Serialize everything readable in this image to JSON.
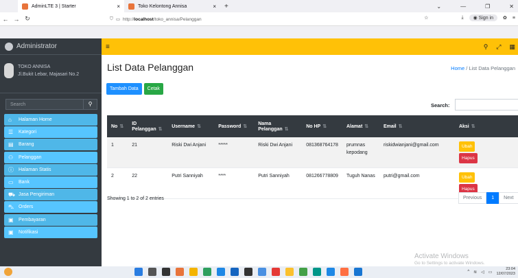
{
  "browser": {
    "tabs": [
      {
        "label": "AdminLTE 3 | Starter",
        "active": true
      },
      {
        "label": "Toko Kelontong Annisa",
        "active": false
      }
    ],
    "url_prefix": "http://",
    "url_host": "localhost",
    "url_path": "/toko_annisa/Pelanggan",
    "signin": "Sign in"
  },
  "sidebar": {
    "brand": "Administrator",
    "user_name": "TOKO ANNISA",
    "user_address": "Jl.Bukit Lebar, Majasari No.2",
    "search_placeholder": "Search",
    "items": [
      {
        "label": "Halaman Home",
        "icon": "home-icon"
      },
      {
        "label": "Kategori",
        "icon": "list-icon"
      },
      {
        "label": "Barang",
        "icon": "box-icon"
      },
      {
        "label": "Pelanggan",
        "icon": "users-icon"
      },
      {
        "label": "Halaman Statis",
        "icon": "info-icon"
      },
      {
        "label": "Bank",
        "icon": "bank-icon"
      },
      {
        "label": "Jasa Pengiriman",
        "icon": "truck-icon"
      },
      {
        "label": "Orders",
        "icon": "cart-icon"
      },
      {
        "label": "Pembayaran",
        "icon": "money-icon"
      },
      {
        "label": "Notifikasi",
        "icon": "bell-icon"
      }
    ]
  },
  "page": {
    "title": "List Data Pelanggan",
    "breadcrumb_home": "Home",
    "breadcrumb_current": "List Data Pelanggan",
    "add_button": "Tambah Data",
    "print_button": "Cetak",
    "search_label": "Search:"
  },
  "table": {
    "columns": [
      "No",
      "ID Pelanggan",
      "Username",
      "Password",
      "Nama Pelanggan",
      "No HP",
      "Alamat",
      "Email",
      "Aksi"
    ],
    "rows": [
      {
        "no": "1",
        "id": "21",
        "username": "Riski Dwi Anjani",
        "password": "*****",
        "nama": "Riski Dwi Anjani",
        "hp": "081368764178",
        "alamat": "prumnas kepodang",
        "email": "riskidwianjani@gmail.com"
      },
      {
        "no": "2",
        "id": "22",
        "username": "Putri Sanniyah",
        "password": "****",
        "nama": "Putri Sanniyah",
        "hp": "081266778809",
        "alamat": "Tuguh Nanas",
        "email": "putri@gmail.com"
      }
    ],
    "edit_label": "Ubah",
    "delete_label": "Hapus"
  },
  "footer": {
    "info": "Showing 1 to 2 of 2 entries",
    "prev": "Previous",
    "page": "1",
    "next": "Next"
  },
  "watermark": {
    "line1": "Activate Windows",
    "line2": "Go to Settings to activate Windows."
  },
  "taskbar": {
    "time": "23:04",
    "date": "12/07/2023"
  }
}
